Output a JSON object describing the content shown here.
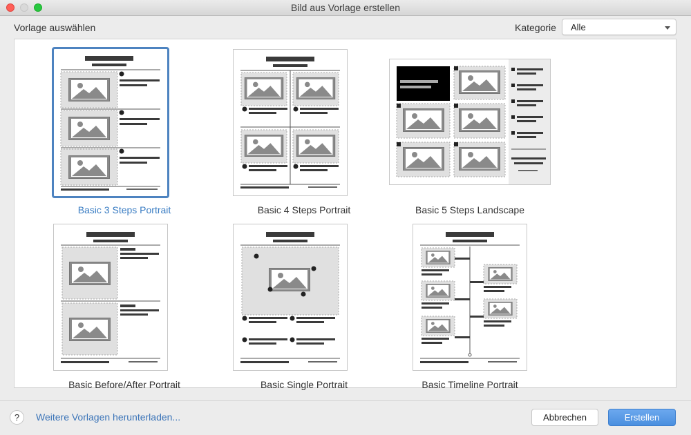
{
  "window": {
    "title": "Bild aus Vorlage erstellen"
  },
  "toolbar": {
    "heading": "Vorlage auswählen",
    "category_label": "Kategorie",
    "category_value": "Alle"
  },
  "templates": [
    {
      "label": "Basic 3 Steps Portrait",
      "selected": true
    },
    {
      "label": "Basic 4 Steps Portrait",
      "selected": false
    },
    {
      "label": "Basic 5 Steps Landscape",
      "selected": false
    },
    {
      "label": "Basic Before/After Portrait",
      "selected": false
    },
    {
      "label": "Basic Single Portrait",
      "selected": false
    },
    {
      "label": "Basic Timeline Portrait",
      "selected": false
    }
  ],
  "footer": {
    "help_label": "?",
    "more_link": "Weitere Vorlagen herunterladen...",
    "cancel_label": "Abbrechen",
    "create_label": "Erstellen"
  },
  "colors": {
    "accent": "#4d83c0",
    "primary_button": "#4a8fdf",
    "link": "#3b74b8"
  }
}
